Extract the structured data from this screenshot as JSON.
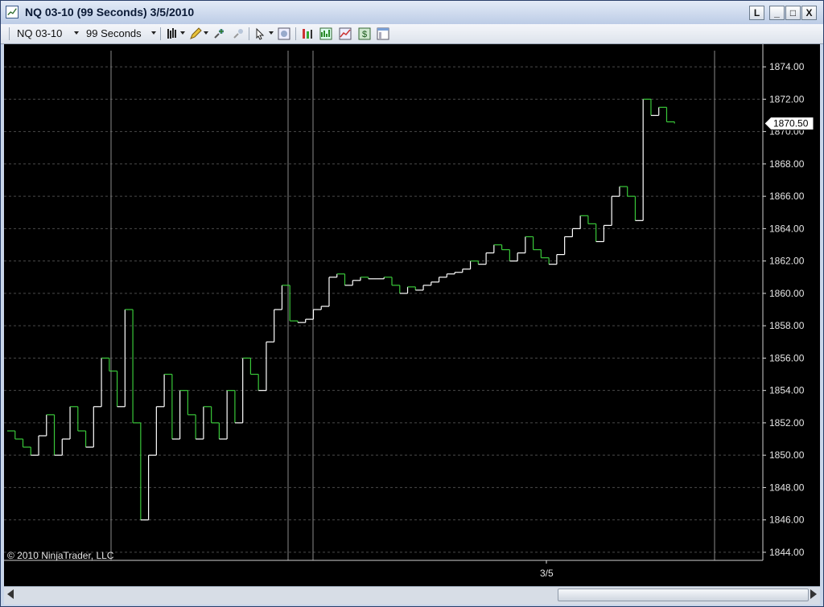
{
  "window": {
    "title": "NQ 03-10 (99 Seconds)  3/5/2010",
    "buttons": {
      "layout": "L",
      "minimize": "_",
      "maximize": "□",
      "close": "X"
    }
  },
  "toolbar": {
    "instrument": "NQ 03-10",
    "interval": "99 Seconds"
  },
  "chart": {
    "copyright": "© 2010 NinjaTrader, LLC",
    "date_label": "3/5",
    "price_marker": "1870.50",
    "colors": {
      "background": "#000000",
      "up": "#ffffff",
      "down": "#39c839",
      "grid": "#555555"
    }
  },
  "chart_data": {
    "type": "line",
    "ylim": [
      1843.5,
      1875
    ],
    "yticks": [
      "1844.00",
      "1846.00",
      "1848.00",
      "1850.00",
      "1852.00",
      "1854.00",
      "1856.00",
      "1858.00",
      "1860.00",
      "1862.00",
      "1864.00",
      "1866.00",
      "1868.00",
      "1870.00",
      "1872.00",
      "1874.00"
    ],
    "x": [
      0,
      10,
      20,
      30,
      40,
      50,
      60,
      70,
      80,
      90,
      100,
      110,
      120,
      130,
      140,
      150,
      160,
      170,
      180,
      190,
      200,
      210,
      220,
      230,
      240,
      250,
      260,
      270,
      280,
      290,
      300,
      310,
      320,
      330,
      340,
      350,
      360,
      370,
      380,
      390,
      400,
      410,
      420,
      430,
      440,
      450,
      460,
      470,
      480,
      490,
      500,
      510,
      520,
      530,
      540,
      550,
      560,
      570,
      580,
      590,
      600,
      610,
      620,
      630,
      640,
      650,
      660,
      670,
      680,
      690,
      700,
      710,
      720,
      730,
      740,
      750,
      760,
      770,
      780,
      790,
      800,
      810,
      820,
      830,
      840,
      850,
      860,
      870,
      880,
      890,
      900
    ],
    "values": [
      1851.5,
      1851,
      1850.5,
      1850,
      1851.2,
      1852.5,
      1850,
      1851,
      1853,
      1851.5,
      1850.5,
      1853,
      1856,
      1855.2,
      1853,
      1859,
      1852,
      1846,
      1850,
      1853,
      1855,
      1851,
      1854,
      1852.5,
      1851,
      1853,
      1852,
      1851,
      1854,
      1852,
      1856,
      1855,
      1854,
      1857,
      1859,
      1860.5,
      1858.3,
      1858.2,
      1858.4,
      1859,
      1859.2,
      1861,
      1861.2,
      1860.5,
      1860.8,
      1861,
      1860.9,
      1860.9,
      1861,
      1860.5,
      1860,
      1860.4,
      1860.2,
      1860.5,
      1860.7,
      1861,
      1861.2,
      1861.3,
      1861.5,
      1862,
      1861.8,
      1862.5,
      1863,
      1862.7,
      1862,
      1862.5,
      1863.5,
      1862.7,
      1862.2,
      1861.8,
      1862.4,
      1863.5,
      1864,
      1864.8,
      1864.3,
      1863.2,
      1864.2,
      1866,
      1866.6,
      1866,
      1864.5,
      1872,
      1871,
      1871.5,
      1870.6,
      1870.5
    ]
  }
}
